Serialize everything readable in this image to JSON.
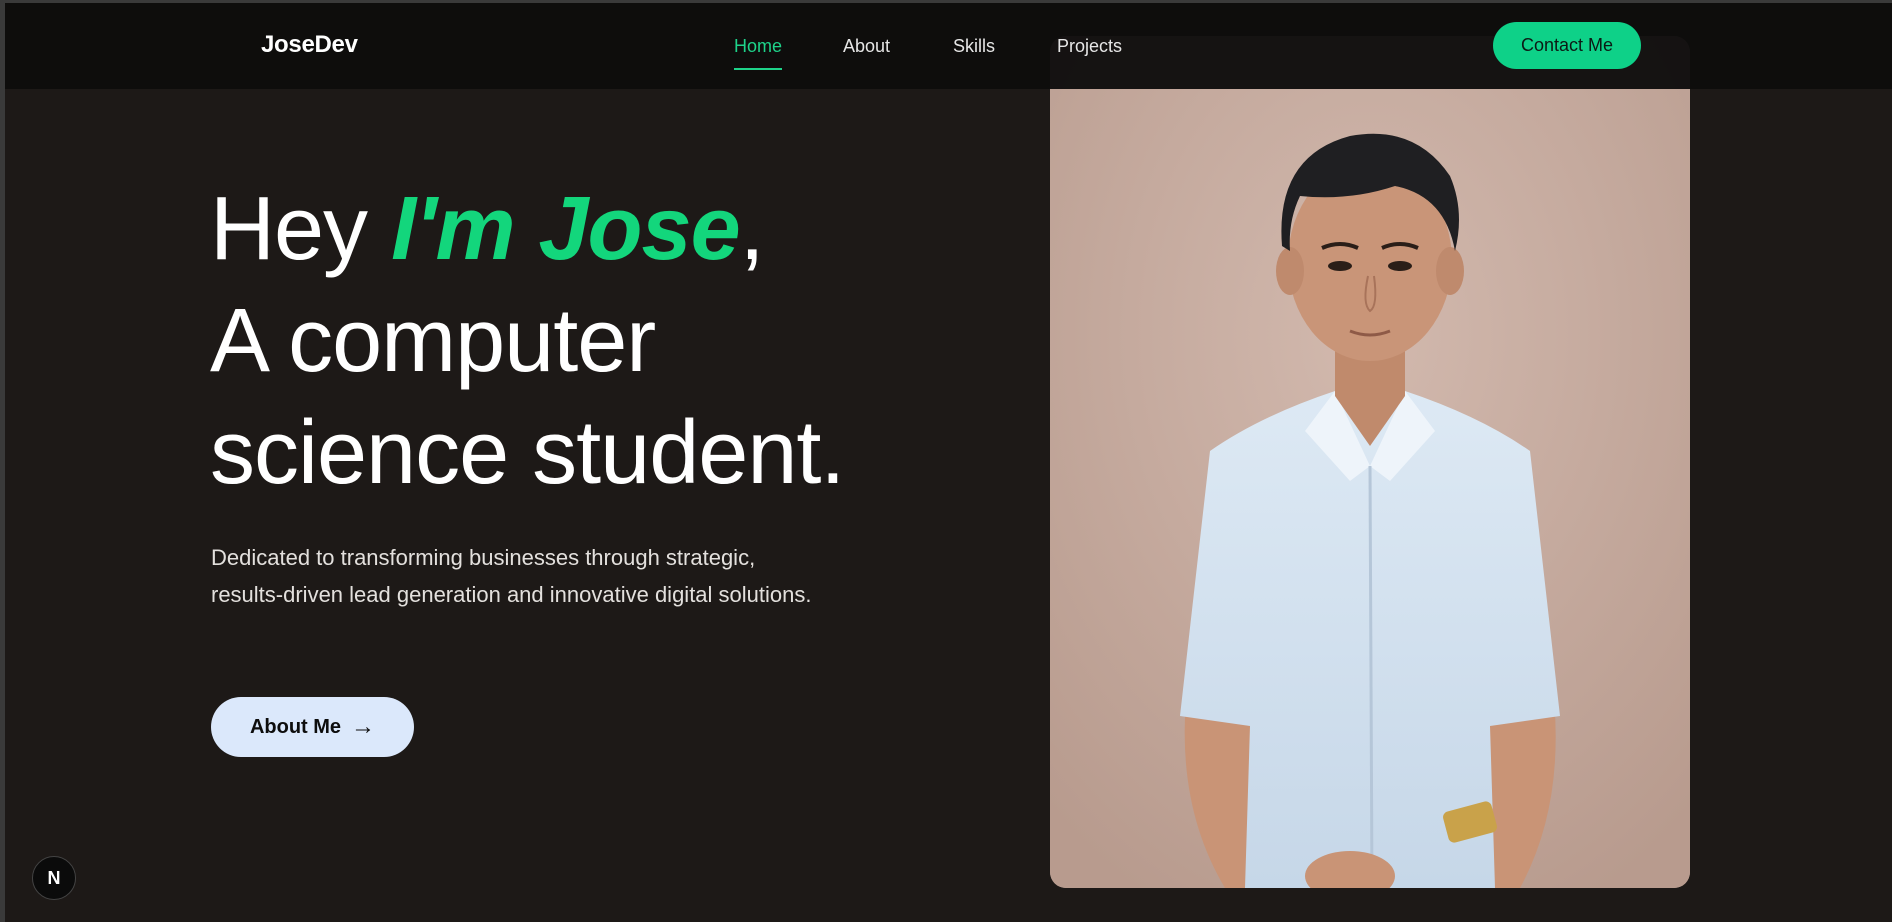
{
  "nav": {
    "brand": "JoseDev",
    "links": [
      {
        "label": "Home",
        "active": true
      },
      {
        "label": "About",
        "active": false
      },
      {
        "label": "Skills",
        "active": false
      },
      {
        "label": "Projects",
        "active": false
      }
    ],
    "contact_label": "Contact Me"
  },
  "hero": {
    "greeting": "Hey ",
    "name": "I'm Jose",
    "comma": ",",
    "line2": "A computer",
    "line3": "science student.",
    "description": "Dedicated to transforming businesses through strategic, results-driven lead generation and innovative digital solutions.",
    "about_button": "About Me",
    "about_arrow": "→"
  },
  "badge": {
    "letter": "N"
  },
  "colors": {
    "accent": "#13d67c",
    "background": "#1d1917",
    "button_light": "#dbe8fb",
    "contact": "#0ed188"
  },
  "icons": {
    "about_arrow": "arrow-right-icon",
    "badge": "nextjs-logo-icon"
  }
}
